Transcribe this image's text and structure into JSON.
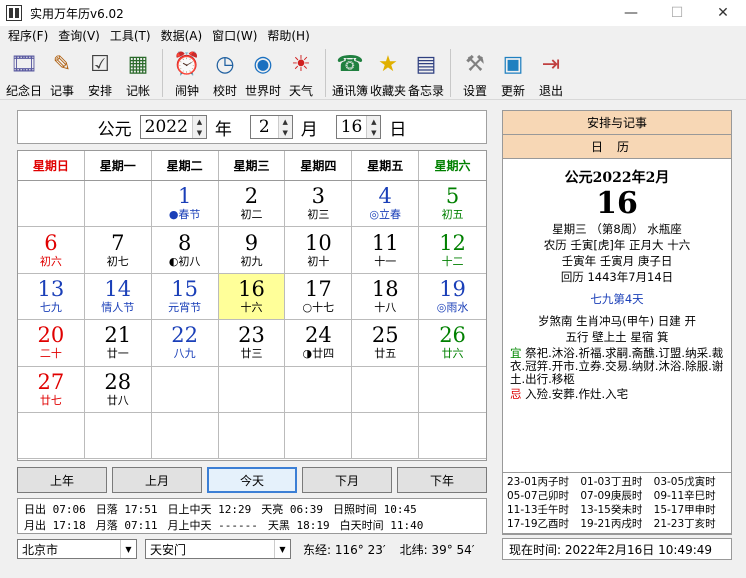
{
  "window": {
    "title": "实用万年历v6.02",
    "minimize": "—",
    "maximize": "☐",
    "close": "✕"
  },
  "menu": [
    "程序(F)",
    "查询(V)",
    "工具(T)",
    "数据(A)",
    "窗口(W)",
    "帮助(H)"
  ],
  "toolbar": [
    {
      "label": "纪念日",
      "icon": "film-icon",
      "glyph": "🎞"
    },
    {
      "label": "记事",
      "icon": "pen-icon",
      "glyph": "✎"
    },
    {
      "label": "安排",
      "icon": "checklist-icon",
      "glyph": "☑"
    },
    {
      "label": "记帐",
      "icon": "calculator-icon",
      "glyph": "▦"
    },
    {
      "label": "闹钟",
      "icon": "alarm-clock-icon",
      "glyph": "⏰"
    },
    {
      "label": "校时",
      "icon": "globe-clock-icon",
      "glyph": "◷"
    },
    {
      "label": "世界时",
      "icon": "world-icon",
      "glyph": "◉"
    },
    {
      "label": "天气",
      "icon": "weather-icon",
      "glyph": "☀"
    },
    {
      "label": "通讯簿",
      "icon": "phone-icon",
      "glyph": "☎"
    },
    {
      "label": "收藏夹",
      "icon": "star-icon",
      "glyph": "★"
    },
    {
      "label": "备忘录",
      "icon": "memo-icon",
      "glyph": "▤"
    },
    {
      "label": "设置",
      "icon": "settings-tools-icon",
      "glyph": "⚒"
    },
    {
      "label": "更新",
      "icon": "update-icon",
      "glyph": "▣"
    },
    {
      "label": "退出",
      "icon": "exit-door-icon",
      "glyph": "⇥"
    }
  ],
  "datebar": {
    "era": "公元",
    "year": "2022",
    "year_unit": "年",
    "month": "2",
    "month_unit": "月",
    "day": "16",
    "day_unit": "日"
  },
  "weekdays": [
    {
      "label": "星期日",
      "color": "#e00000"
    },
    {
      "label": "星期一",
      "color": "#000000"
    },
    {
      "label": "星期二",
      "color": "#000000"
    },
    {
      "label": "星期三",
      "color": "#000000"
    },
    {
      "label": "星期四",
      "color": "#000000"
    },
    {
      "label": "星期五",
      "color": "#000000"
    },
    {
      "label": "星期六",
      "color": "#008000"
    }
  ],
  "calendar_cells": [
    {
      "d": "",
      "l": ""
    },
    {
      "d": "",
      "l": ""
    },
    {
      "d": "1",
      "l": "●春节",
      "dc": "#1a3fb8",
      "lc": "#1a3fb8"
    },
    {
      "d": "2",
      "l": "初二"
    },
    {
      "d": "3",
      "l": "初三"
    },
    {
      "d": "4",
      "l": "◎立春",
      "dc": "#1a3fb8",
      "lc": "#1a3fb8"
    },
    {
      "d": "5",
      "l": "初五",
      "dc": "#008000",
      "lc": "#008000"
    },
    {
      "d": "6",
      "l": "初六",
      "dc": "#e00000",
      "lc": "#e00000"
    },
    {
      "d": "7",
      "l": "初七"
    },
    {
      "d": "8",
      "l": "◐初八"
    },
    {
      "d": "9",
      "l": "初九"
    },
    {
      "d": "10",
      "l": "初十"
    },
    {
      "d": "11",
      "l": "十一"
    },
    {
      "d": "12",
      "l": "十二",
      "dc": "#008000",
      "lc": "#008000"
    },
    {
      "d": "13",
      "l": "七九",
      "dc": "#1a3fb8",
      "lc": "#1a3fb8"
    },
    {
      "d": "14",
      "l": "情人节",
      "dc": "#1a3fb8",
      "lc": "#1a3fb8"
    },
    {
      "d": "15",
      "l": "元宵节",
      "dc": "#1a3fb8",
      "lc": "#1a3fb8"
    },
    {
      "d": "16",
      "l": "十六",
      "today": true
    },
    {
      "d": "17",
      "l": "○十七"
    },
    {
      "d": "18",
      "l": "十八"
    },
    {
      "d": "19",
      "l": "◎雨水",
      "dc": "#1a3fb8",
      "lc": "#1a3fb8"
    },
    {
      "d": "20",
      "l": "二十",
      "dc": "#e00000",
      "lc": "#e00000"
    },
    {
      "d": "21",
      "l": "廿一"
    },
    {
      "d": "22",
      "l": "八九",
      "dc": "#1a3fb8",
      "lc": "#1a3fb8"
    },
    {
      "d": "23",
      "l": "廿三"
    },
    {
      "d": "24",
      "l": "◑廿四"
    },
    {
      "d": "25",
      "l": "廿五"
    },
    {
      "d": "26",
      "l": "廿六",
      "dc": "#008000",
      "lc": "#008000"
    },
    {
      "d": "27",
      "l": "廿七",
      "dc": "#e00000",
      "lc": "#e00000"
    },
    {
      "d": "28",
      "l": "廿八"
    },
    {
      "d": "",
      "l": ""
    },
    {
      "d": "",
      "l": ""
    },
    {
      "d": "",
      "l": ""
    },
    {
      "d": "",
      "l": ""
    },
    {
      "d": "",
      "l": ""
    },
    {
      "d": "",
      "l": ""
    },
    {
      "d": "",
      "l": ""
    },
    {
      "d": "",
      "l": ""
    },
    {
      "d": "",
      "l": ""
    },
    {
      "d": "",
      "l": ""
    },
    {
      "d": "",
      "l": ""
    },
    {
      "d": "",
      "l": ""
    }
  ],
  "nav": {
    "prev_year": "上年",
    "prev_month": "上月",
    "today": "今天",
    "next_month": "下月",
    "next_year": "下年"
  },
  "sun": {
    "row1": [
      "日出 07:06",
      "日落 17:51",
      "日上中天 12:29",
      "天亮 06:39",
      "日照时间 10:45"
    ],
    "row2": [
      "月出 17:18",
      "月落 07:11",
      "月上中天 ------",
      "天黑 18:19",
      "白天时间 11:40"
    ]
  },
  "location": {
    "city": "北京市",
    "place": "天安门",
    "longitude": "东经: 116° 23′",
    "latitude": "北纬: 39° 54′"
  },
  "right": {
    "header": "安排与记事",
    "subheader": "日历",
    "year_month": "公元2022年2月",
    "day": "16",
    "line1": "星期三 （第8周） 水瓶座",
    "line2": "农历 壬寅[虎]年 正月大 十六",
    "line3": "壬寅年 壬寅月 庚子日",
    "line4": "回历 1443年7月14日",
    "line5": "七九第4天",
    "line6": "岁煞南 生肖冲马(甲午) 日建 开",
    "line7": "五行 壁上土 星宿 箕",
    "yi_tag": "宜",
    "yi": "祭祀.沐浴.祈福.求嗣.斋醮.订盟.纳采.裁衣.冠笄.开市.立券.交易.纳财.沐浴.除服.谢土.出行.移柩",
    "ji_tag": "忌",
    "ji": "入殓.安葬.作灶.入宅"
  },
  "hours": [
    "23-01丙子时",
    "01-03丁丑时",
    "03-05戊寅时",
    "05-07己卯时",
    "07-09庚辰时",
    "09-11辛巳时",
    "11-13壬午时",
    "13-15癸未时",
    "15-17甲申时",
    "17-19乙酉时",
    "19-21丙戌时",
    "21-23丁亥时"
  ],
  "now": "现在时间: 2022年2月16日 10:49:49"
}
